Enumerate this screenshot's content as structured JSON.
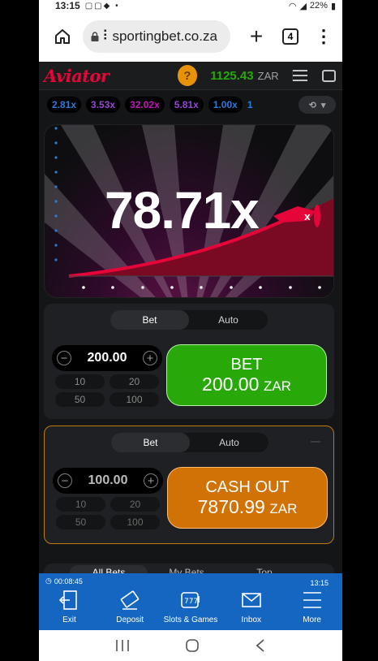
{
  "status_bar": {
    "time": "13:15",
    "battery": "22%"
  },
  "browser": {
    "url": "sportingbet.co.za",
    "url_prefix": "⠇",
    "tab_count": "4"
  },
  "game": {
    "logo": "Aviator",
    "help_label": "?",
    "balance": "1125.43",
    "currency": "ZAR",
    "multipliers": [
      {
        "value": "2.81x",
        "color": "#2d7ad8"
      },
      {
        "value": "3.53x",
        "color": "#9646d6"
      },
      {
        "value": "32.02x",
        "color": "#c017b4"
      },
      {
        "value": "5.81x",
        "color": "#9646d6"
      },
      {
        "value": "1.00x",
        "color": "#2d7ad8"
      },
      {
        "value": "1",
        "color": "#2d7ad8"
      }
    ],
    "crash_value": "78.71x",
    "accent": "#e50539"
  },
  "bet_panel_1": {
    "tab_bet": "Bet",
    "tab_auto": "Auto",
    "stake": "200.00",
    "quick": [
      "10",
      "20",
      "50",
      "100"
    ],
    "button_label": "BET",
    "button_amount": "200.00",
    "button_currency": "ZAR"
  },
  "bet_panel_2": {
    "tab_bet": "Bet",
    "tab_auto": "Auto",
    "stake": "100.00",
    "quick": [
      "10",
      "20",
      "50",
      "100"
    ],
    "button_label": "CASH OUT",
    "button_amount": "7870.99",
    "button_currency": "ZAR"
  },
  "bets_tabs": [
    "All Bets",
    "My Bets",
    "Top"
  ],
  "bottom_nav": {
    "timer": "00:08:45",
    "clock": "13:15",
    "items": [
      {
        "label": "Exit",
        "icon": "exit-icon"
      },
      {
        "label": "Deposit",
        "icon": "deposit-icon"
      },
      {
        "label": "Slots & Games",
        "icon": "slots-icon"
      },
      {
        "label": "Inbox",
        "icon": "inbox-icon"
      },
      {
        "label": "More",
        "icon": "more-icon"
      }
    ]
  }
}
